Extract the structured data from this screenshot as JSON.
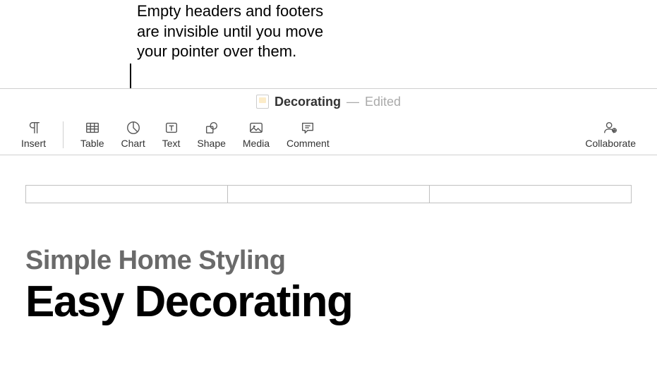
{
  "annotation": {
    "line1": "Empty headers and footers",
    "line2": "are invisible until you move",
    "line3": "your pointer over them."
  },
  "titlebar": {
    "document_name": "Decorating",
    "dash": "—",
    "status": "Edited"
  },
  "toolbar": {
    "insert": "Insert",
    "table": "Table",
    "chart": "Chart",
    "text": "Text",
    "shape": "Shape",
    "media": "Media",
    "comment": "Comment",
    "collaborate": "Collaborate"
  },
  "document": {
    "subtitle": "Simple Home Styling",
    "title": "Easy Decorating"
  }
}
